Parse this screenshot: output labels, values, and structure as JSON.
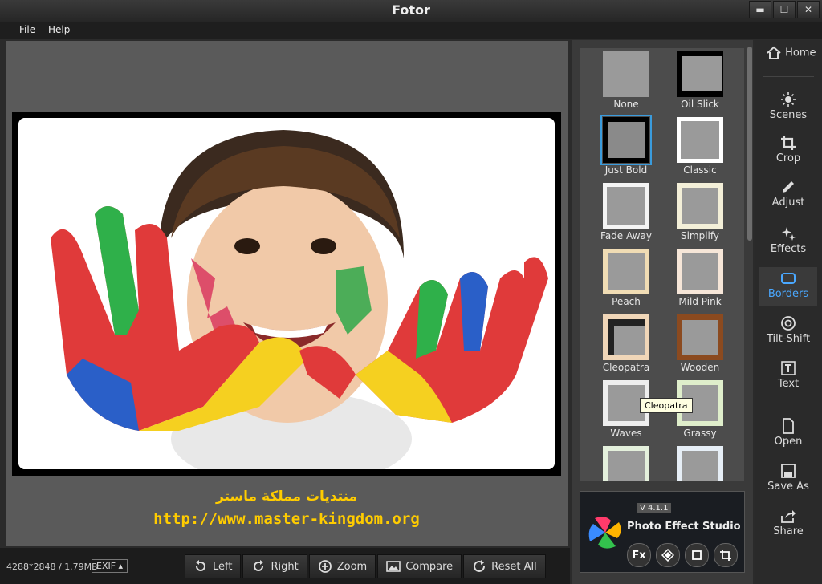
{
  "window": {
    "title": "Fotor",
    "minimize": "▬",
    "maximize": "☐",
    "close": "✕"
  },
  "menu": {
    "file": "File",
    "help": "Help"
  },
  "watermark": {
    "line1": "منتديات مملكة ماستر",
    "line2": "http://www.master-kingdom.org"
  },
  "status": {
    "info": "4288*2848 / 1.79MB",
    "exif": "EXIF ▴"
  },
  "toolbar": {
    "left": "Left",
    "right": "Right",
    "zoom": "Zoom",
    "compare": "Compare",
    "reset_all": "Reset All"
  },
  "borders": {
    "items": [
      "None",
      "Oil Slick",
      "Just Bold",
      "Classic",
      "Fade Away",
      "Simplify",
      "Peach",
      "Mild Pink",
      "Cleopatra",
      "Wooden",
      "Waves",
      "Grassy"
    ],
    "selected": "Just Bold",
    "tooltip": "Cleopatra"
  },
  "promo": {
    "version": "V 4.1.1",
    "title": "Photo Effect Studio",
    "fx": "Fx"
  },
  "sidebar": {
    "home": "Home",
    "scenes": "Scenes",
    "crop": "Crop",
    "adjust": "Adjust",
    "effects": "Effects",
    "borders": "Borders",
    "tilt_shift": "Tilt-Shift",
    "text": "Text",
    "open": "Open",
    "save_as": "Save As",
    "share": "Share"
  },
  "colors": {
    "accent": "#4aa8ff",
    "watermark": "#ffcc00",
    "selection": "#3a9bdc"
  }
}
